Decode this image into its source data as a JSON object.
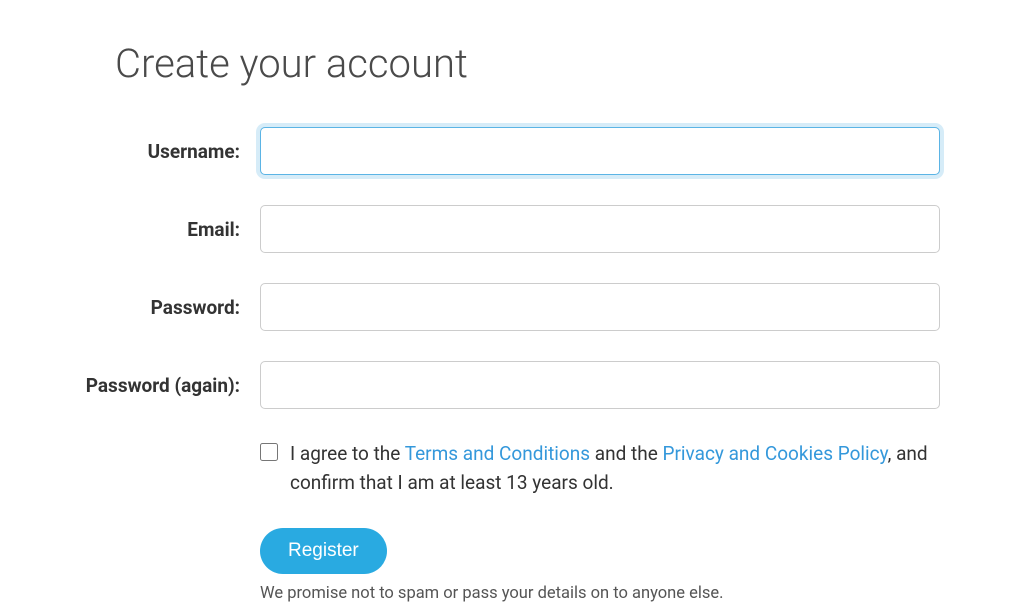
{
  "title": "Create your account",
  "form": {
    "username": {
      "label": "Username:",
      "value": ""
    },
    "email": {
      "label": "Email:",
      "value": ""
    },
    "password": {
      "label": "Password:",
      "value": ""
    },
    "password2": {
      "label": "Password (again):",
      "value": ""
    }
  },
  "agreement": {
    "checked": false,
    "text_part1": "I agree to the ",
    "terms_link": "Terms and Conditions",
    "text_part2": " and the ",
    "privacy_link": "Privacy and Cookies Policy",
    "text_part3": ", and confirm that I am at least 13 years old."
  },
  "submit_label": "Register",
  "privacy_note": "We promise not to spam or pass your details on to anyone else."
}
